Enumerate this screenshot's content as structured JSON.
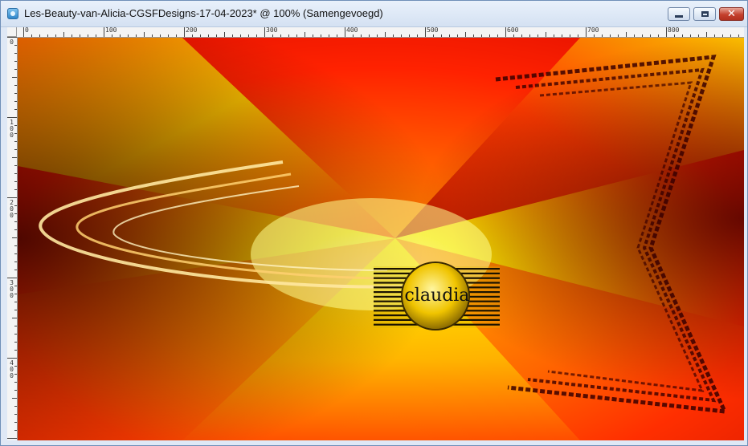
{
  "window": {
    "title": "Les-Beauty-van-Alicia-CGSFDesigns-17-04-2023* @ 100% (Samengevoegd)",
    "app_icon": "paintshop-pro-icon",
    "controls": {
      "minimize": "minimize-icon",
      "maximize": "maximize-icon",
      "close": "close-icon"
    },
    "close_glyph": "✕"
  },
  "ruler": {
    "horizontal_labels": [
      "0",
      "100",
      "200",
      "300",
      "400",
      "500",
      "600",
      "700",
      "800"
    ],
    "vertical_labels": [
      "0",
      "100",
      "200",
      "300",
      "400"
    ]
  },
  "canvas": {
    "zoom": "100%",
    "watermark_text": "claudia",
    "colors": {
      "red": "#ff1a00",
      "orange": "#ff7a00",
      "yellow": "#fff200",
      "dark": "#5a0000"
    }
  }
}
